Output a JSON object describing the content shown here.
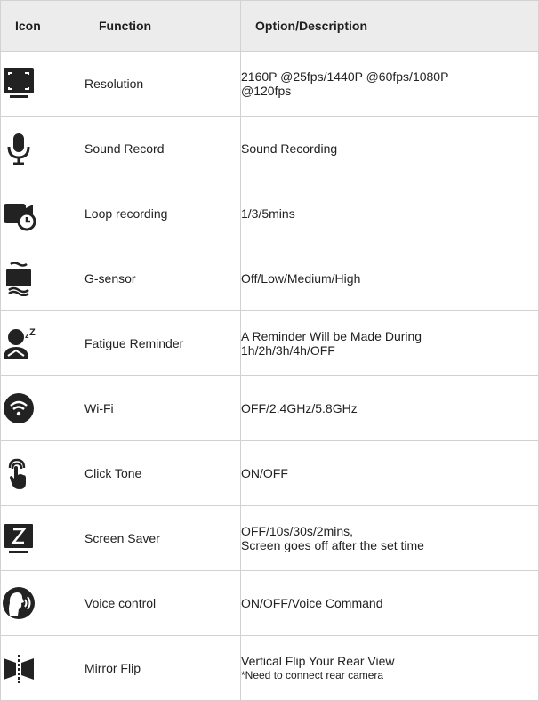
{
  "table": {
    "headers": {
      "icon": "Icon",
      "function": "Function",
      "description": "Option/Description"
    },
    "rows": [
      {
        "icon": "resolution-frame-icon",
        "function": "Resolution",
        "desc": [
          "2160P @25fps/1440P @60fps/1080P",
          "@120fps"
        ]
      },
      {
        "icon": "microphone-icon",
        "function": "Sound Record",
        "desc": [
          "Sound Recording"
        ]
      },
      {
        "icon": "loop-recording-camera-clock-icon",
        "function": "Loop recording",
        "desc": [
          "1/3/5mins"
        ]
      },
      {
        "icon": "g-sensor-vibration-icon",
        "function": "G-sensor",
        "desc": [
          "Off/Low/Medium/High"
        ]
      },
      {
        "icon": "fatigue-sleeping-driver-icon",
        "function": "Fatigue Reminder",
        "desc": [
          "A Reminder Will be Made During",
          "1h/2h/3h/4h/OFF"
        ]
      },
      {
        "icon": "wifi-icon",
        "function": "Wi-Fi",
        "desc": [
          "OFF/2.4GHz/5.8GHz"
        ]
      },
      {
        "icon": "touch-tap-icon",
        "function": "Click Tone",
        "desc": [
          "ON/OFF"
        ]
      },
      {
        "icon": "screen-saver-z-icon",
        "function": "Screen Saver",
        "desc": [
          "OFF/10s/30s/2mins,",
          "Screen goes off after the set time"
        ]
      },
      {
        "icon": "voice-control-head-icon",
        "function": "Voice control",
        "desc": [
          "ON/OFF/Voice Command"
        ]
      },
      {
        "icon": "mirror-flip-icon",
        "function": "Mirror Flip",
        "desc": [
          "Vertical Flip Your Rear View"
        ],
        "note": "*Need to connect rear camera"
      }
    ]
  }
}
